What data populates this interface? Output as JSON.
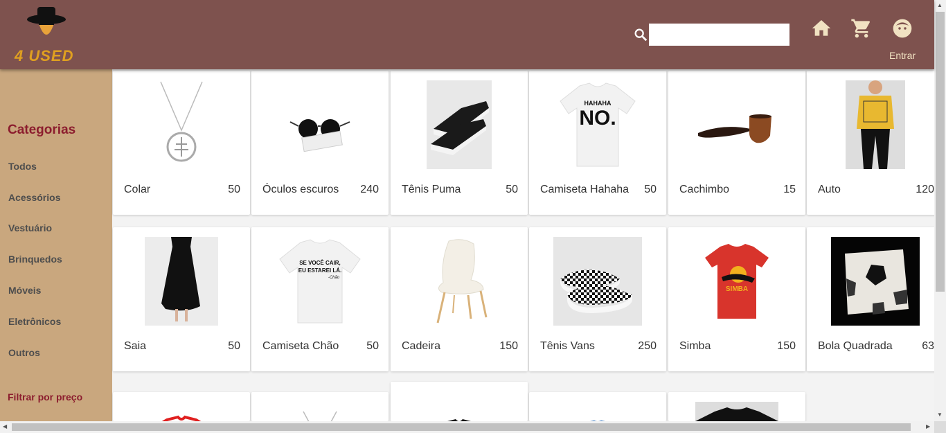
{
  "header": {
    "logo_text": "4 USED",
    "search_placeholder": "",
    "login_label": "Entrar",
    "colors": {
      "header_bg": "#7e524e",
      "accent": "#f1e2c2"
    }
  },
  "icons": {
    "search": "search-icon",
    "home": "home-icon",
    "cart": "cart-icon",
    "user": "user-icon"
  },
  "sidebar": {
    "title": "Categorias",
    "items": [
      "Todos",
      "Acessórios",
      "Vestuário",
      "Brinquedos",
      "Móveis",
      "Eletrônicos",
      "Outros"
    ],
    "filter_label": "Filtrar por preço",
    "colors": {
      "bg": "#c9a77e",
      "title": "#8c1d2e"
    }
  },
  "products": [
    {
      "name": "Colar",
      "price": "50"
    },
    {
      "name": "Óculos escuros",
      "price": "240"
    },
    {
      "name": "Tênis Puma",
      "price": "50"
    },
    {
      "name": "Camiseta Hahaha",
      "price": "50"
    },
    {
      "name": "Cachimbo",
      "price": "15"
    },
    {
      "name": "Auto",
      "price": "120"
    },
    {
      "name": "Saia",
      "price": "50"
    },
    {
      "name": "Camiseta Chão",
      "price": "50"
    },
    {
      "name": "Cadeira",
      "price": "150"
    },
    {
      "name": "Tênis Vans",
      "price": "250"
    },
    {
      "name": "Simba",
      "price": "150"
    },
    {
      "name": "Bola Quadrada",
      "price": "63"
    }
  ],
  "product_images": {
    "tshirt_hahaha_text": "HAHAHA NO.",
    "tshirt_chao_text": "SE VOCÊ CAIR, EU ESTAREI LÁ. -Chão",
    "simba_text": "SIMBA"
  }
}
